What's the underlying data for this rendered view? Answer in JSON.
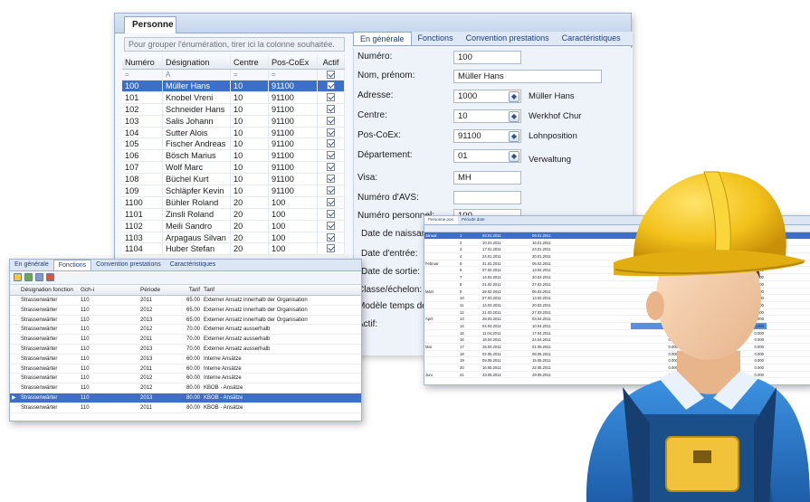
{
  "main_window": {
    "tab_title": "Personne",
    "group_hint": "Pour grouper l'énumération, tirer ici la colonne souhaitée.",
    "columns": [
      "Numéro",
      "Désignation",
      "Centre",
      "Pos-CoEx",
      "Actif"
    ],
    "filter_row": [
      "=",
      "A",
      "=",
      "=",
      ""
    ],
    "rows": [
      {
        "num": "100",
        "name": "Müller Hans",
        "centre": "10",
        "pos": "91100",
        "active": true
      },
      {
        "num": "101",
        "name": "Knobel Vreni",
        "centre": "10",
        "pos": "91100",
        "active": true
      },
      {
        "num": "102",
        "name": "Schneider Hans",
        "centre": "10",
        "pos": "91100",
        "active": true
      },
      {
        "num": "103",
        "name": "Salis Johann",
        "centre": "10",
        "pos": "91100",
        "active": true
      },
      {
        "num": "104",
        "name": "Sutter Alois",
        "centre": "10",
        "pos": "91100",
        "active": true
      },
      {
        "num": "105",
        "name": "Fischer Andreas",
        "centre": "10",
        "pos": "91100",
        "active": true
      },
      {
        "num": "106",
        "name": "Bösch Marius",
        "centre": "10",
        "pos": "91100",
        "active": true
      },
      {
        "num": "107",
        "name": "Wolf Marc",
        "centre": "10",
        "pos": "91100",
        "active": true
      },
      {
        "num": "108",
        "name": "Büchel Kurt",
        "centre": "10",
        "pos": "91100",
        "active": true
      },
      {
        "num": "109",
        "name": "Schläpfer Kevin",
        "centre": "10",
        "pos": "91100",
        "active": true
      },
      {
        "num": "1100",
        "name": "Bühler Roland",
        "centre": "20",
        "pos": "100",
        "active": true
      },
      {
        "num": "1101",
        "name": "Zinsli Roland",
        "centre": "20",
        "pos": "100",
        "active": true
      },
      {
        "num": "1102",
        "name": "Meili Sandro",
        "centre": "20",
        "pos": "100",
        "active": true
      },
      {
        "num": "1103",
        "name": "Arpagaus Silvan",
        "centre": "20",
        "pos": "100",
        "active": true
      },
      {
        "num": "1104",
        "name": "Huber Stefan",
        "centre": "20",
        "pos": "100",
        "active": true
      }
    ],
    "detail_tabs": [
      "En générale",
      "Fonctions",
      "Convention prestations",
      "Caractéristiques"
    ],
    "form": {
      "numero_label": "Numéro:",
      "numero": "100",
      "nom_label": "Nom, prénom:",
      "nom": "Müller Hans",
      "adresse_label": "Adresse:",
      "adresse": "1000",
      "adresse_name": "Müller Hans",
      "centre_label": "Centre:",
      "centre": "10",
      "centre_name": "Werkhof Chur",
      "pos_label": "Pos-CoEx:",
      "pos": "91100",
      "pos_name": "Lohnposition",
      "dept_label": "Département:",
      "dept": "01",
      "dept_name": "Verwaltung",
      "visa_label": "Visa:",
      "visa": "MH",
      "avs_label": "Numéro d'AVS:",
      "personnel_label": "Numéro personnel:",
      "personnel": "100",
      "naissance_label": "Date de naissance:",
      "entree_label": "Date d'entrée:",
      "sortie_label": "Date de sortie:",
      "classe_label": "Classe/échelon:",
      "modele_label": "Modèle temps de ...",
      "actif_label": "Actif:"
    }
  },
  "left_window": {
    "tabs": [
      "En générale",
      "Fonctions",
      "Convention prestations",
      "Caractéristiques"
    ],
    "columns": [
      "Désignation fonction",
      "Gch-i",
      "Période",
      "Tarif",
      "Tarif"
    ],
    "rows": [
      {
        "f": "Strassenwärter",
        "g": "110",
        "p": "2011",
        "t": "65.00",
        "d": "Externer Ansatz innerhalb der Organisation"
      },
      {
        "f": "Strassenwärter",
        "g": "110",
        "p": "2012",
        "t": "65.00",
        "d": "Externer Ansatz innerhalb der Organisation"
      },
      {
        "f": "Strassenwärter",
        "g": "110",
        "p": "2013",
        "t": "65.00",
        "d": "Externer Ansatz innerhalb der Organisation"
      },
      {
        "f": "Strassenwärter",
        "g": "110",
        "p": "2012",
        "t": "70.00",
        "d": "Externer Ansatz ausserhalb"
      },
      {
        "f": "Strassenwärter",
        "g": "110",
        "p": "2011",
        "t": "70.00",
        "d": "Externer Ansatz ausserhalb"
      },
      {
        "f": "Strassenwärter",
        "g": "110",
        "p": "2013",
        "t": "70.00",
        "d": "Externer Ansatz ausserhalb"
      },
      {
        "f": "Strassenwärter",
        "g": "110",
        "p": "2013",
        "t": "60.00",
        "d": "Interne Ansätze"
      },
      {
        "f": "Strassenwärter",
        "g": "110",
        "p": "2011",
        "t": "60.00",
        "d": "Interne Ansätze"
      },
      {
        "f": "Strassenwärter",
        "g": "110",
        "p": "2012",
        "t": "60.00",
        "d": "Interne Ansätze"
      },
      {
        "f": "Strassenwärter",
        "g": "110",
        "p": "2012",
        "t": "80.00",
        "d": "KBOB - Ansätze"
      },
      {
        "f": "Strassenwärter",
        "g": "110",
        "p": "2013",
        "t": "80.00",
        "d": "KBOB - Ansätze"
      },
      {
        "f": "Strassenwärter",
        "g": "110",
        "p": "2011",
        "t": "80.00",
        "d": "KBOB - Ansätze"
      }
    ],
    "selected_index": 10
  },
  "right_window": {
    "tabs": [
      "Personne pos.",
      "Période date"
    ],
    "rows": [
      {
        "m": "Januar",
        "w": "1",
        "a": "03.01.2011",
        "b": "09.01.2011"
      },
      {
        "m": "",
        "w": "2",
        "a": "10.01.2011",
        "b": "16.01.2011"
      },
      {
        "m": "",
        "w": "3",
        "a": "17.01.2011",
        "b": "23.01.2011"
      },
      {
        "m": "",
        "w": "4",
        "a": "24.01.2011",
        "b": "30.01.2011"
      },
      {
        "m": "Februar",
        "w": "5",
        "a": "31.01.2011",
        "b": "06.02.2011"
      },
      {
        "m": "",
        "w": "6",
        "a": "07.02.2011",
        "b": "13.02.2011"
      },
      {
        "m": "",
        "w": "7",
        "a": "14.02.2011",
        "b": "20.02.2011"
      },
      {
        "m": "",
        "w": "8",
        "a": "21.02.2011",
        "b": "27.02.2011"
      },
      {
        "m": "März",
        "w": "9",
        "a": "28.02.2011",
        "b": "06.03.2011"
      },
      {
        "m": "",
        "w": "10",
        "a": "07.03.2011",
        "b": "13.03.2011"
      },
      {
        "m": "",
        "w": "11",
        "a": "14.03.2011",
        "b": "20.03.2011"
      },
      {
        "m": "",
        "w": "12",
        "a": "21.03.2011",
        "b": "27.03.2011"
      },
      {
        "m": "April",
        "w": "13",
        "a": "28.03.2011",
        "b": "03.04.2011"
      },
      {
        "m": "",
        "w": "14",
        "a": "04.04.2011",
        "b": "10.04.2011"
      },
      {
        "m": "",
        "w": "15",
        "a": "11.04.2011",
        "b": "17.04.2011"
      },
      {
        "m": "",
        "w": "16",
        "a": "18.04.2011",
        "b": "24.04.2011"
      },
      {
        "m": "Mai",
        "w": "17",
        "a": "25.04.2011",
        "b": "01.05.2011"
      },
      {
        "m": "",
        "w": "18",
        "a": "02.05.2011",
        "b": "08.05.2011"
      },
      {
        "m": "",
        "w": "19",
        "a": "09.05.2011",
        "b": "15.05.2011"
      },
      {
        "m": "",
        "w": "20",
        "a": "16.05.2011",
        "b": "22.05.2011"
      },
      {
        "m": "Juni",
        "w": "21",
        "a": "23.05.2011",
        "b": "29.05.2011"
      }
    ],
    "value": "0.000"
  },
  "colors": {
    "accent": "#3d6fc6",
    "helmet": "#f2c21b",
    "shirt": "#2e7fd0",
    "overall": "#1b4f8a"
  }
}
